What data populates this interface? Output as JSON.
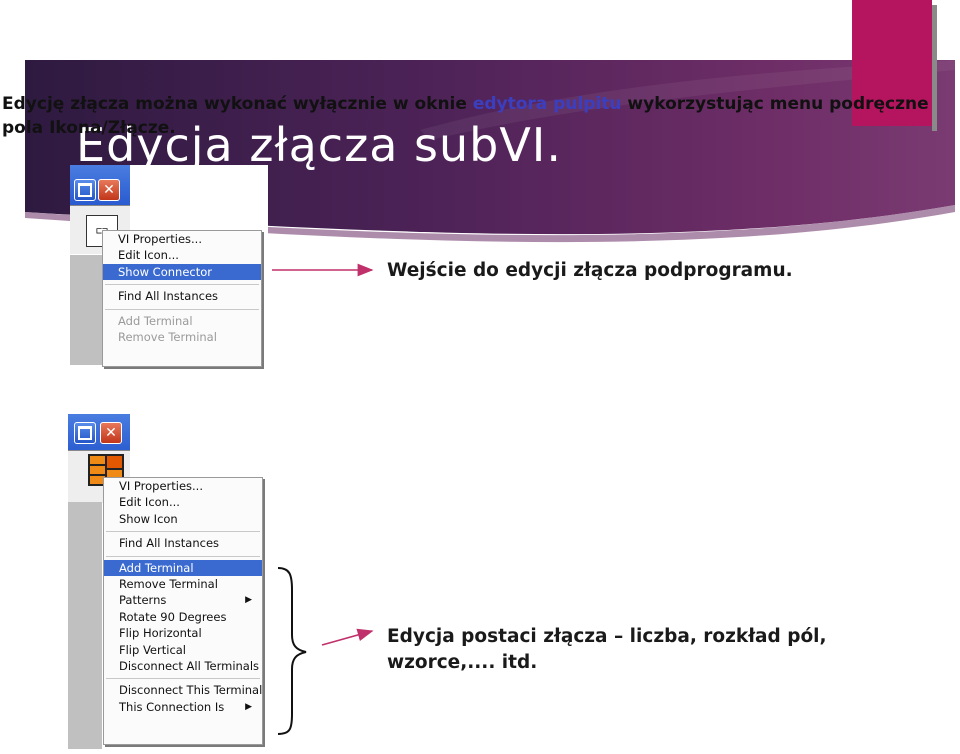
{
  "intro": {
    "part1": "Edycję złącza można wykonać wyłącznie w oknie ",
    "highlight": "edytora pulpitu",
    "part2": " wykorzystując menu podręczne pola Ikona/Złącze."
  },
  "title": "Edycja złącza subVI.",
  "menu1": {
    "items": [
      {
        "label": "VI Properties...",
        "state": "normal"
      },
      {
        "label": "Edit Icon...",
        "state": "normal"
      },
      {
        "label": "Show Connector",
        "state": "selected"
      },
      {
        "sep": true
      },
      {
        "label": "Find All Instances",
        "state": "normal"
      },
      {
        "sep": true
      },
      {
        "label": "Add Terminal",
        "state": "disabled"
      },
      {
        "label": "Remove Terminal",
        "state": "disabled"
      }
    ]
  },
  "caption1": "Wejście do edycji złącza podprogramu.",
  "menu2": {
    "items": [
      {
        "label": "VI Properties...",
        "state": "normal"
      },
      {
        "label": "Edit Icon...",
        "state": "normal"
      },
      {
        "label": "Show Icon",
        "state": "normal"
      },
      {
        "sep": true
      },
      {
        "label": "Find All Instances",
        "state": "normal"
      },
      {
        "sep": true
      },
      {
        "label": "Add Terminal",
        "state": "selected"
      },
      {
        "label": "Remove Terminal",
        "state": "normal"
      },
      {
        "label": "Patterns",
        "state": "normal",
        "submenu": true
      },
      {
        "label": "Rotate 90 Degrees",
        "state": "normal"
      },
      {
        "label": "Flip Horizontal",
        "state": "normal"
      },
      {
        "label": "Flip Vertical",
        "state": "normal"
      },
      {
        "label": "Disconnect All Terminals",
        "state": "normal"
      },
      {
        "sep": true
      },
      {
        "label": "Disconnect This Terminal",
        "state": "normal"
      },
      {
        "label": "This Connection Is",
        "state": "normal",
        "submenu": true
      }
    ]
  },
  "caption2_line1": "Edycja postaci złącza – liczba, rozkład pól,",
  "caption2_line2": "wzorce,.... itd.",
  "icons": {
    "max": "maximize-icon",
    "close": "close-icon",
    "submenu": "submenu-arrow-icon",
    "connector": "connector-pane-icon"
  },
  "colors": {
    "banner_dark": "#3a1f4a",
    "banner_mid": "#6b2f6a",
    "accent": "#b5145e",
    "highlight_text": "#3b3fbf",
    "menu_selected": "#3a6ad0",
    "arrow": "#c0306a"
  }
}
